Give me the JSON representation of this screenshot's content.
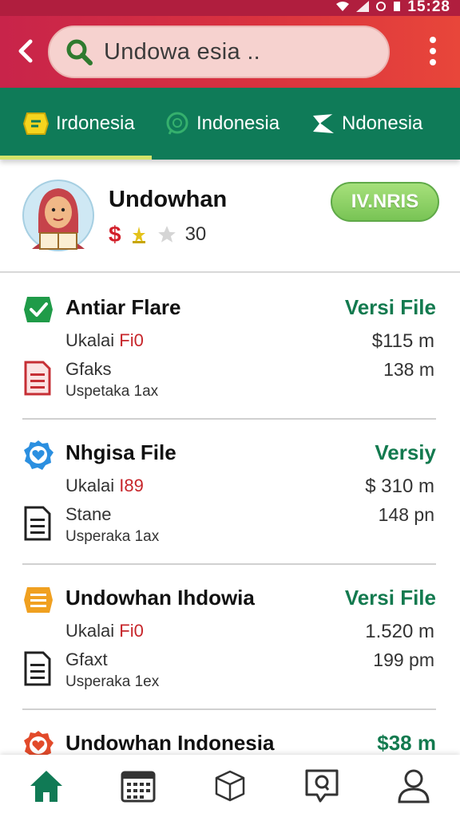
{
  "status_bar": {
    "time": "15:28"
  },
  "header": {
    "search_text": "Undowa esia ..",
    "icons": [
      "back-arrow-icon",
      "search-icon",
      "more-vertical-icon"
    ],
    "colors": {
      "start": "#c8244a",
      "end": "#e8463a"
    }
  },
  "tabs": [
    {
      "label": "Irdonesia",
      "icon": "chat-badge-icon",
      "active": true
    },
    {
      "label": "Indonesia",
      "icon": "whatsapp-icon",
      "active": false
    },
    {
      "label": "Ndonesia",
      "icon": "send-icon",
      "active": false
    }
  ],
  "profile": {
    "name": "Undowhan",
    "rating": "30",
    "badge": "IV.NRIS",
    "dollar": "$"
  },
  "items": [
    {
      "title": "Antiar Flare",
      "link": "Versi File",
      "sub_label": "Ukalai",
      "sub_code": "Fi0",
      "price": "$115 m",
      "name": "Gfaks",
      "desc": "Uspetaka 1ax",
      "time": "138 m",
      "icon": "check-badge-icon",
      "icon_color": "#1f9b48"
    },
    {
      "title": "Nhgisa File",
      "link": "Versiy",
      "sub_label": "Ukalai",
      "sub_code": "I89",
      "price": "$ 310 m",
      "name": "Stane",
      "desc": "Usperaka 1ax",
      "time": "148 pn",
      "icon": "heart-badge-icon",
      "icon_color": "#2b8fe0"
    },
    {
      "title": "Undowhan Ihdowia",
      "link": "Versi File",
      "sub_label": "Ukalai",
      "sub_code": "Fi0",
      "price": "1.520 m",
      "name": "Gfaxt",
      "desc": "Usperaka 1ex",
      "time": "199 pm",
      "icon": "list-badge-icon",
      "icon_color": "#f0a020"
    },
    {
      "title": "Undowhan Indonesia",
      "link": "$38 m",
      "icon": "heart-badge-icon",
      "icon_color": "#e24a2a"
    }
  ],
  "bottom_nav": [
    "home-icon",
    "calendar-icon",
    "cube-icon",
    "chat-search-icon",
    "profile-icon"
  ]
}
